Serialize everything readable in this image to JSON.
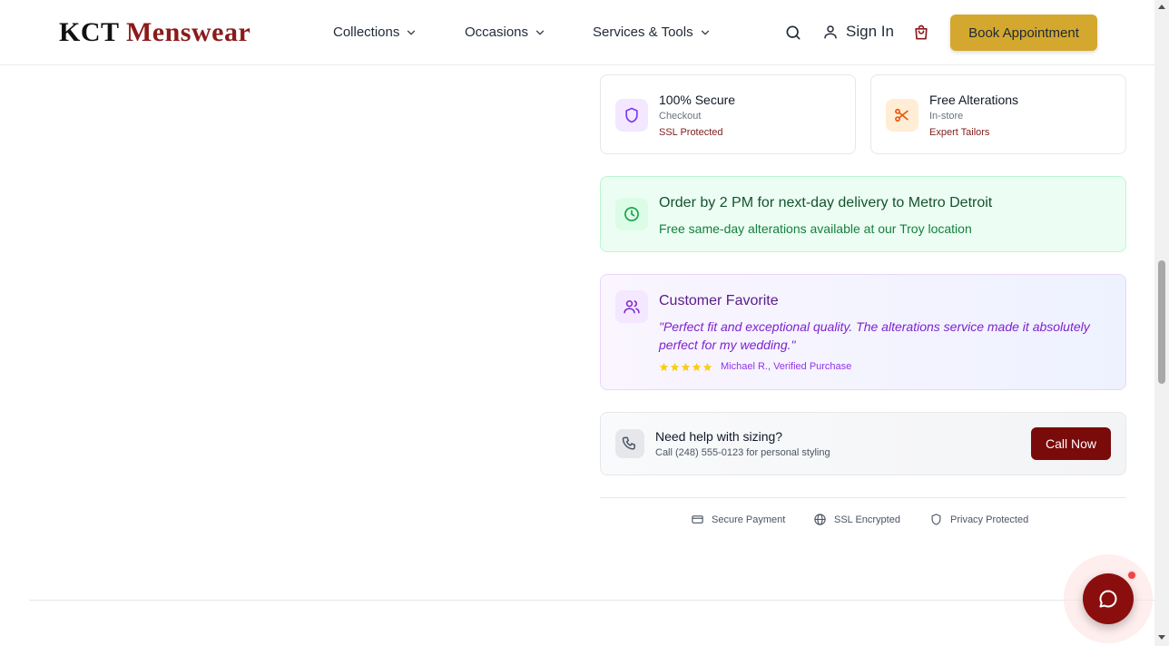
{
  "header": {
    "logo_main": "KCT",
    "logo_accent": "Menswear",
    "nav": [
      {
        "label": "Collections"
      },
      {
        "label": "Occasions"
      },
      {
        "label": "Services & Tools"
      }
    ],
    "sign_in": "Sign In",
    "book_button": "Book Appointment",
    "icons": [
      "search-icon",
      "user-icon",
      "shopping-bag-icon",
      "chevron-down-icon"
    ]
  },
  "badges": [
    {
      "title": "100% Secure",
      "subtitle": "Checkout",
      "highlight": "SSL Protected",
      "icon": "shield-icon",
      "icon_color": "#7c3aed",
      "icon_bg": "#f3e8ff"
    },
    {
      "title": "Free Alterations",
      "subtitle": "In-store",
      "highlight": "Expert Tailors",
      "icon": "scissors-icon",
      "icon_color": "#ea580c",
      "icon_bg": "#ffedd5"
    }
  ],
  "delivery": {
    "title": "Order by 2 PM for next-day delivery to Metro Detroit",
    "subtitle": "Free same-day alterations available at our Troy location",
    "icon": "clock-icon",
    "color": "#16a34a"
  },
  "favorite": {
    "title": "Customer Favorite",
    "quote": "\"Perfect fit and exceptional quality. The alterations service made it absolutely perfect for my wedding.\"",
    "stars": 5,
    "reviewer": "Michael R., Verified Purchase",
    "icon": "users-icon",
    "color": "#7e22ce"
  },
  "sizing": {
    "title": "Need help with sizing?",
    "subtitle": "Call (248) 555-0123 for personal styling",
    "button": "Call Now",
    "icon": "phone-icon"
  },
  "trust": [
    {
      "label": "Secure Payment",
      "icon": "credit-card-icon"
    },
    {
      "label": "SSL Encrypted",
      "icon": "globe-icon"
    },
    {
      "label": "Privacy Protected",
      "icon": "shield-outline-icon"
    }
  ],
  "chat": {
    "icon": "chat-bubble-icon",
    "notification": true
  },
  "colors": {
    "brand": "#7a0b0b",
    "gold": "#d4a82e"
  }
}
